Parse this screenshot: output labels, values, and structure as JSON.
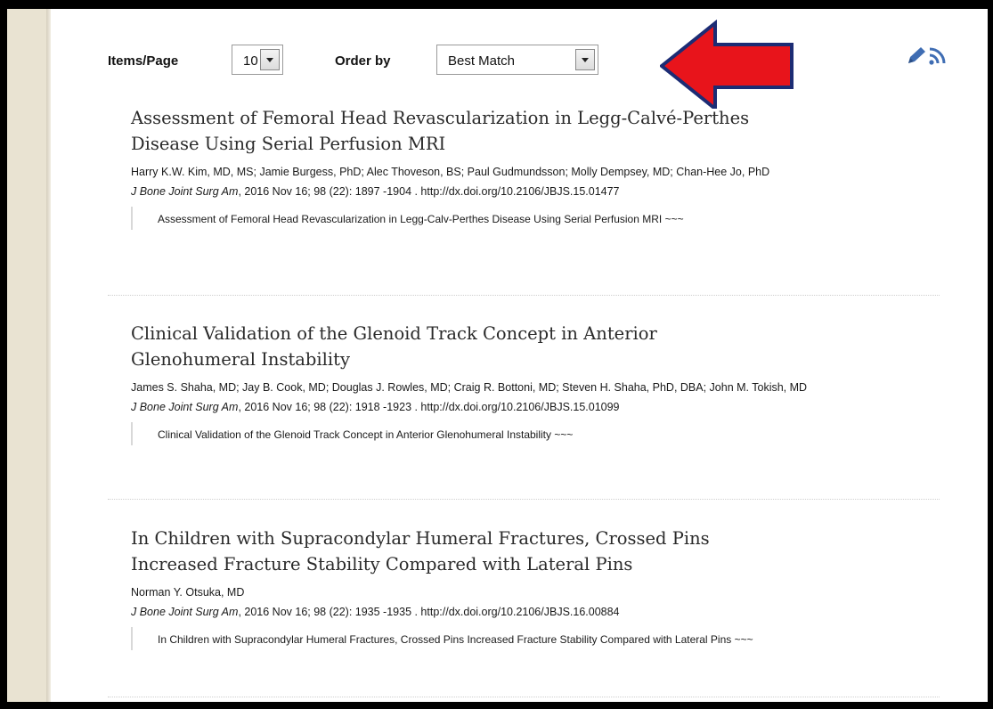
{
  "toolbar": {
    "items_label": "Items/Page",
    "items_value": "10",
    "order_label": "Order by",
    "order_value": "Best Match"
  },
  "icons": [
    "pencil-icon",
    "rss-icon"
  ],
  "annotation": {
    "arrow_color": "#e8141b",
    "arrow_outline": "#1c2c74"
  },
  "results": [
    {
      "title_line1": "Assessment of Femoral Head Revascularization in Legg-Calvé-Perthes",
      "title_line2": "Disease Using Serial Perfusion MRI",
      "authors": "Harry K.W. Kim, MD, MS; Jamie Burgess, PhD; Alec Thoveson, BS; Paul Gudmundsson; Molly Dempsey, MD; Chan-Hee Jo, PhD",
      "journal": "J Bone Joint Surg Am",
      "citation_rest": ", 2016 Nov 16; 98 (22): 1897 -1904 . http://dx.doi.org/10.2106/JBJS.15.01477",
      "abstract": "Assessment of Femoral Head Revascularization in Legg-Calv-Perthes Disease Using Serial Perfusion MRI ~~~"
    },
    {
      "title_line1": "Clinical Validation of the Glenoid Track Concept in Anterior",
      "title_line2": "Glenohumeral Instability",
      "authors": "James S. Shaha, MD; Jay B. Cook, MD; Douglas J. Rowles, MD; Craig R. Bottoni, MD; Steven H. Shaha, PhD, DBA; John M. Tokish, MD",
      "journal": "J Bone Joint Surg Am",
      "citation_rest": ", 2016 Nov 16; 98 (22): 1918 -1923 . http://dx.doi.org/10.2106/JBJS.15.01099",
      "abstract": "Clinical Validation of the Glenoid Track Concept in Anterior Glenohumeral Instability ~~~"
    },
    {
      "title_line1": "In Children with Supracondylar Humeral Fractures, Crossed Pins",
      "title_line2": "Increased Fracture Stability Compared with Lateral Pins",
      "authors": "Norman Y. Otsuka, MD",
      "journal": "J Bone Joint Surg Am",
      "citation_rest": ", 2016 Nov 16; 98 (22): 1935 -1935 . http://dx.doi.org/10.2106/JBJS.16.00884",
      "abstract": "In Children with Supracondylar Humeral Fractures, Crossed Pins Increased Fracture Stability Compared with Lateral Pins ~~~"
    }
  ]
}
